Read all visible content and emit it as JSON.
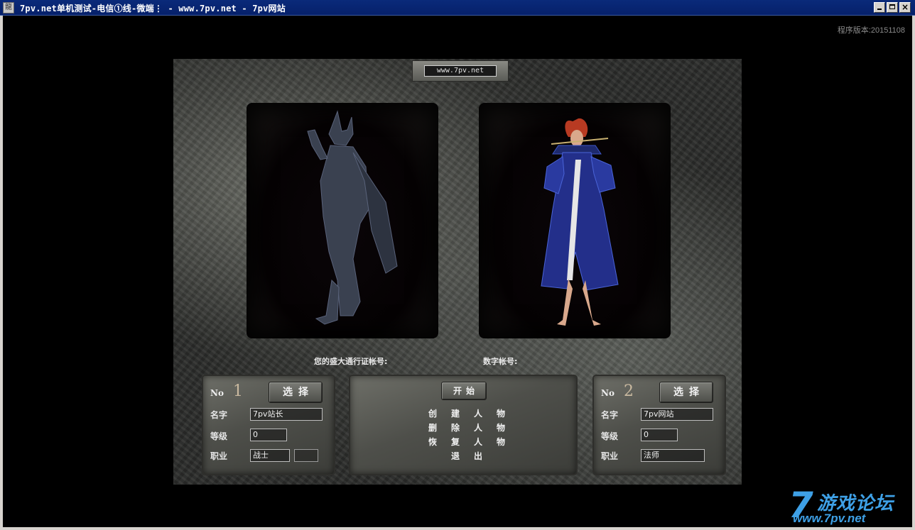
{
  "window": {
    "title": "7pv.net单机测试-电信①线-微端⋮ - www.7pv.net - 7pv网站",
    "icon": "app-icon",
    "buttons": {
      "minimize": "minimize",
      "maximize": "maximize",
      "close": "×"
    }
  },
  "version_text": "程序版本:20151108",
  "scene": {
    "url_plaque": "www.7pv.net",
    "account_label": "您的盛大通行证帐号:",
    "digit_account_label": "数字帐号:"
  },
  "slots": [
    {
      "no_label": "No",
      "number": "1",
      "select_label": "选择",
      "name_label": "名字",
      "name_value": "7pv站长",
      "level_label": "等级",
      "level_value": "0",
      "job_label": "职业",
      "job_value": "战士",
      "character_icon": "warrior-figure"
    },
    {
      "no_label": "No",
      "number": "2",
      "select_label": "选择",
      "name_label": "名字",
      "name_value": "7pv网站",
      "level_label": "等级",
      "level_value": "0",
      "job_label": "职业",
      "job_value": "法师",
      "character_icon": "mage-figure"
    }
  ],
  "menu": {
    "start": "开始",
    "create": [
      "创",
      "建",
      "人",
      "物"
    ],
    "delete": [
      "删",
      "除",
      "人",
      "物"
    ],
    "restore": [
      "恢",
      "复",
      "人",
      "物"
    ],
    "exit": [
      "退",
      "出"
    ]
  },
  "forum_logo": {
    "seven": "7",
    "text": "游戏论坛",
    "site": "www.7pv.net"
  },
  "colors": {
    "titlebar": "#0a2a7a",
    "logo": "#3ea0e6",
    "frame": "#d6d3ce"
  }
}
